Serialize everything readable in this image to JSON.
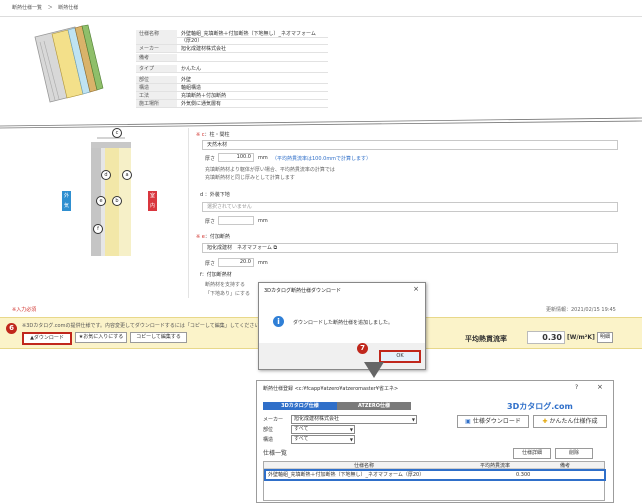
{
  "breadcrumb": [
    "断熱仕様一覧",
    "＞",
    "断熱仕様"
  ],
  "spec_table": [
    {
      "key": "仕様名称",
      "value": "外壁軸組_充填断熱＋付加断熱（下地無し）_ネオマフォーム"
    },
    {
      "key": "",
      "value": "（厚20）"
    },
    {
      "key": "メーカー",
      "value": "旭化成建材株式会社"
    },
    {
      "key": "備考",
      "value": ""
    },
    {
      "key": "タイプ",
      "value": "かんたん"
    },
    {
      "key": "部位",
      "value": "外壁"
    },
    {
      "key": "構造",
      "value": "軸組構造"
    },
    {
      "key": "工法",
      "value": "充填断熱＋付加断熱"
    },
    {
      "key": "施工場所",
      "value": "外気側に通気層有"
    }
  ],
  "diagram": {
    "outside_label": "外気",
    "inside_label": "室内",
    "markers": [
      "a",
      "b",
      "c",
      "d",
      "e",
      "f"
    ]
  },
  "mid": {
    "sec_c": {
      "required": "※ c",
      "title": "：柱・間柱",
      "material": "天然木材",
      "thickness_label": "厚さ",
      "thickness": "100.0",
      "unit": "mm",
      "note": "（平均熱貫流率は100.0mmで計算します）",
      "hint1": "充填断熱材より躯体が厚い場合、平均熱貫流率の計算では",
      "hint2": "充填断熱材と同じ厚みとして計算します"
    },
    "sec_d": {
      "title": "d ：外装下地",
      "placeholder": "選択されていません",
      "thickness_label": "厚さ",
      "unit": "mm"
    },
    "sec_e": {
      "required": "※ e",
      "title": "：付加断熱",
      "material_key": "旭化成建材",
      "material": "ネオマフォーム",
      "thickness_label": "厚さ",
      "thickness": "20.0",
      "unit": "mm"
    },
    "sec_f": {
      "title": "f：付加断熱材",
      "hint1": "断熱材を支持する",
      "hint2": "「下地あり」にする"
    },
    "required_note": "※入力必須",
    "updated": "更新情報：2021/02/15 19:45"
  },
  "bottom_bar": {
    "notice": "※3Dカタログ.comの提供仕様です。内容変更してダウンロードするには「コピーして編集」してください。",
    "download": "▲ダウンロード",
    "favorite": "★お気に入りにする",
    "copy_edit": "コピーして編集する",
    "avg_label": "平均熱貫流率",
    "avg_value": "0.30",
    "avg_unit": "[W/m²K]",
    "detail": "明細"
  },
  "steps": {
    "six": "6",
    "seven": "7"
  },
  "popup": {
    "title": "3Dカタログ断熱仕様ダウンロード",
    "close": "×",
    "icon": "info-icon",
    "message": "ダウンロードした断熱仕様を追加しました。",
    "ok": "OK"
  },
  "lower": {
    "title": "断熱仕様登録 <c:¥fcapp¥atzero¥atzeromaster¥省エネ>",
    "help": "?",
    "close": "×",
    "tab1": "3Dカタログ仕様",
    "tab2": "ATZERO仕様",
    "logo": "3Dカタログ.com",
    "manufacturer_label": "メーカー",
    "manufacturer": "旭化成建材株式会社",
    "part_label": "部位",
    "part": "すべて",
    "struct_label": "構造",
    "struct": "すべて",
    "spec_download": "仕様ダウンロード",
    "simple_create": "かんたん仕様作成",
    "list_label": "仕様一覧",
    "spec_detail": "仕様詳細",
    "delete": "削除",
    "col_name": "仕様名称",
    "col_avg": "平均熱貫流率",
    "col_remark": "備考",
    "row_name": "外壁軸組_充填断熱＋付加断熱（下地無し）_ネオマフォーム（厚20）",
    "row_avg": "0.300"
  },
  "colors": {
    "accent_blue": "#2f6fc9",
    "step_red": "#c0271c",
    "bar_yellow": "#fbf3c9",
    "wood": "#d9b36a"
  }
}
